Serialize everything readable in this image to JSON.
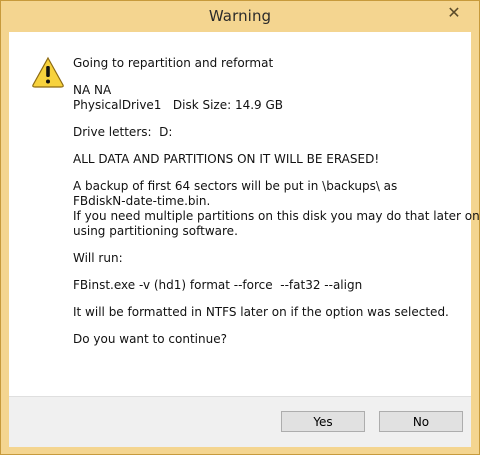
{
  "window": {
    "title": "Warning",
    "close_glyph": "✕",
    "icon": "warning-icon"
  },
  "message": {
    "line1": "Going to repartition and reformat",
    "line2": "NA NA",
    "line3": "PhysicalDrive1   Disk Size: 14.9 GB",
    "line4": "Drive letters:  D:",
    "line5": "ALL DATA AND PARTITIONS ON IT WILL BE ERASED!",
    "line6": "A backup of first 64 sectors will be put in \\backups\\ as",
    "line7": "FBdiskN-date-time.bin.",
    "line8": "If you need multiple partitions on this disk you may do that later on,",
    "line9": "using partitioning software.",
    "line10": "Will run:",
    "line11": "FBinst.exe -v (hd1) format --force  --fat32 --align",
    "line12": "It will be formatted in NTFS later on if the option was selected.",
    "line13": "Do you want to continue?"
  },
  "buttons": {
    "yes": "Yes",
    "no": "No"
  },
  "colors": {
    "titlebar": "#f4d590",
    "dialog_bg": "#ffffff",
    "footer_bg": "#f0f0f0",
    "warning_yellow": "#f7d23d"
  }
}
